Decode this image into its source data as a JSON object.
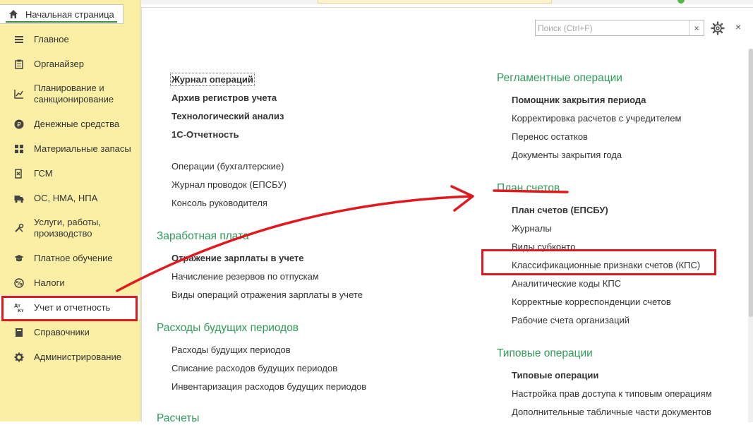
{
  "sidebar": {
    "home_tab": "Начальная страница",
    "items": [
      {
        "label": "Главное",
        "icon": "menu-lines-icon"
      },
      {
        "label": "Органайзер",
        "icon": "clipboard-icon"
      },
      {
        "label": "Планирование и санкционирование",
        "icon": "chart-icon"
      },
      {
        "label": "Денежные средства",
        "icon": "ruble-coin-icon"
      },
      {
        "label": "Материальные запасы",
        "icon": "grid-icon"
      },
      {
        "label": "ГСМ",
        "icon": "fuel-icon"
      },
      {
        "label": "ОС, НМА, НПА",
        "icon": "truck-icon"
      },
      {
        "label": "Услуги, работы, производство",
        "icon": "tools-icon"
      },
      {
        "label": "Платное обучение",
        "icon": "graduation-cap-icon"
      },
      {
        "label": "Налоги",
        "icon": "tax-icon"
      },
      {
        "label": "Учет и отчетность",
        "icon": "dt-kt-icon"
      },
      {
        "label": "Справочники",
        "icon": "book-icon"
      },
      {
        "label": "Администрирование",
        "icon": "gear-icon"
      }
    ]
  },
  "search": {
    "placeholder": "Поиск (Ctrl+F)",
    "clear": "×"
  },
  "window": {
    "close": "×"
  },
  "left_column": {
    "top_links": [
      "Журнал операций",
      "Архив регистров учета",
      "Технологический анализ",
      "1С-Отчетность"
    ],
    "plain_links": [
      "Операции (бухгалтерские)",
      "Журнал проводок (ЕПСБУ)",
      "Консоль руководителя"
    ],
    "salary": {
      "title": "Заработная плата",
      "links": [
        "Отражение зарплаты в учете",
        "Начисление резервов по отпускам",
        "Виды операций отражения зарплаты в учете"
      ]
    },
    "deferred": {
      "title": "Расходы будущих периодов",
      "links": [
        "Расходы будущих периодов",
        "Списание расходов будущих периодов",
        "Инвентаризация расходов будущих периодов"
      ]
    },
    "settlements": {
      "title": "Расчеты"
    }
  },
  "right_column": {
    "regl": {
      "title": "Регламентные операции",
      "links": [
        "Помощник закрытия периода",
        "Корректировка расчетов с учредителем",
        "Перенос остатков",
        "Документы закрытия года"
      ]
    },
    "chart_of_accounts": {
      "title": "План счетов",
      "links": [
        "План счетов (ЕПСБУ)",
        "Журналы",
        "Виды субконто",
        "Классификационные признаки счетов (КПС)",
        "Аналитические коды КПС",
        "Корректные корреспонденции счетов",
        "Рабочие счета организаций"
      ]
    },
    "typical": {
      "title": "Типовые операции",
      "links": [
        "Типовые операции",
        "Настройка прав доступа к типовым операциям",
        "Дополнительные табличные части документов"
      ]
    }
  },
  "colors": {
    "accent_green": "#2f9a57",
    "sidebar_bg": "#fbeea5",
    "annotation_red": "#e0191f"
  }
}
